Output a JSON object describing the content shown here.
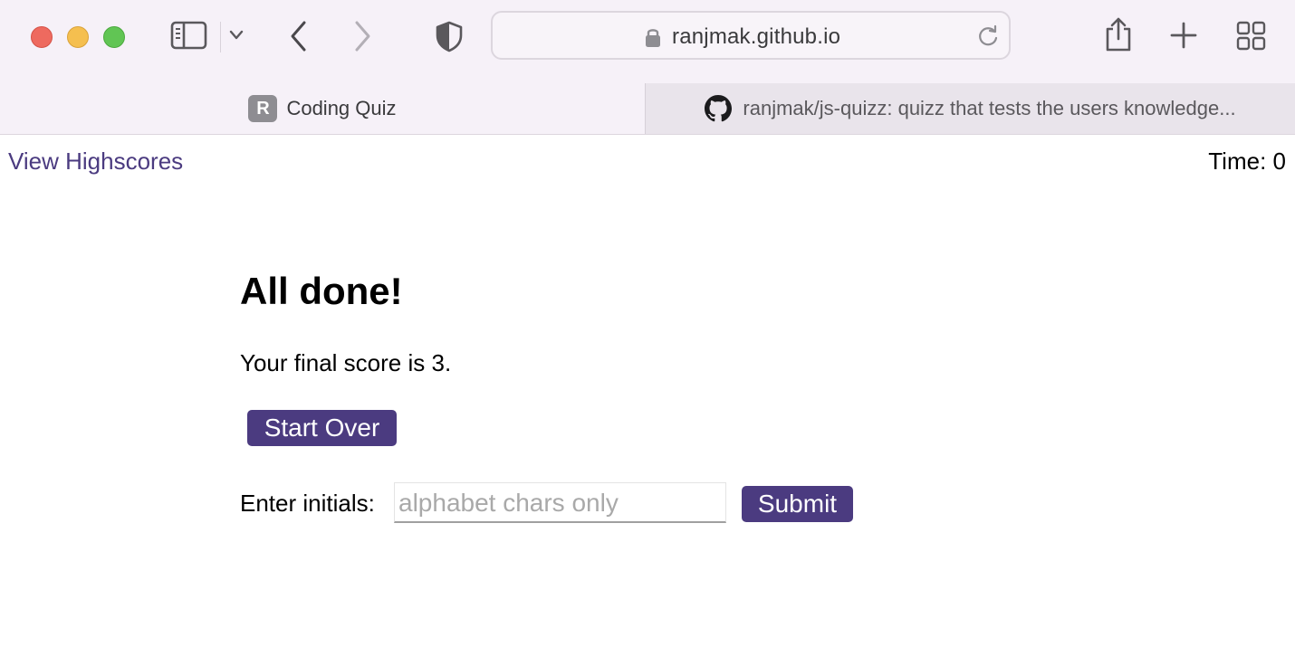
{
  "browser": {
    "url": "ranjmak.github.io",
    "tabs": [
      {
        "favicon_letter": "R",
        "title": "Coding Quiz",
        "active": true
      },
      {
        "title": "ranjmak/js-quizz: quizz that tests the users knowledge...",
        "active": false
      }
    ],
    "icons": {
      "sidebar": "sidebar-icon",
      "chevron": "chevron-down-icon",
      "back": "back-icon",
      "forward": "forward-icon",
      "privacy": "shield-icon",
      "lock": "lock-icon",
      "reload": "reload-icon",
      "share": "share-icon",
      "new_tab": "plus-icon",
      "tab_overview": "grid-icon",
      "github": "github-icon"
    }
  },
  "page": {
    "highscores_link": "View Highscores",
    "timer_label": "Time: ",
    "timer_value": "0",
    "heading": "All done!",
    "score_text": "Your final score is 3.",
    "start_over_label": "Start Over",
    "initials_label": "Enter initials:",
    "initials_placeholder": "alphabet chars only",
    "initials_value": "",
    "submit_label": "Submit"
  },
  "colors": {
    "accent": "#4b3b80",
    "chrome_bg": "#f6f1f8",
    "inactive_tab_bg": "#e9e4eb"
  }
}
